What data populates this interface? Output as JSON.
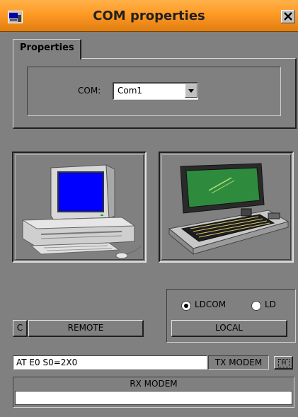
{
  "window": {
    "title": "COM properties"
  },
  "icons": {
    "app": "app-icon",
    "close": "close-icon"
  },
  "tabs": [
    {
      "label": "Properties"
    }
  ],
  "com": {
    "label": "COM:",
    "value": "Com1"
  },
  "panels": {
    "remote_image": "desktop-computer-image",
    "local_image": "laptop-computer-image"
  },
  "options": {
    "ldcom_label": "LDCOM",
    "ld_label": "LD",
    "selected": "LDCOM"
  },
  "buttons": {
    "c_label": "C",
    "remote_label": "REMOTE",
    "local_label": "LOCAL",
    "tx_button_label": "H"
  },
  "tx": {
    "command": "AT E0 S0=2X0",
    "label": "TX MODEM"
  },
  "rx": {
    "label": "RX MODEM",
    "value": ""
  },
  "colors": {
    "titlebar": "#ff9a26",
    "window_bg": "#808080",
    "screen_blue": "#0000ff",
    "screen_green": "#2e8b3e"
  }
}
